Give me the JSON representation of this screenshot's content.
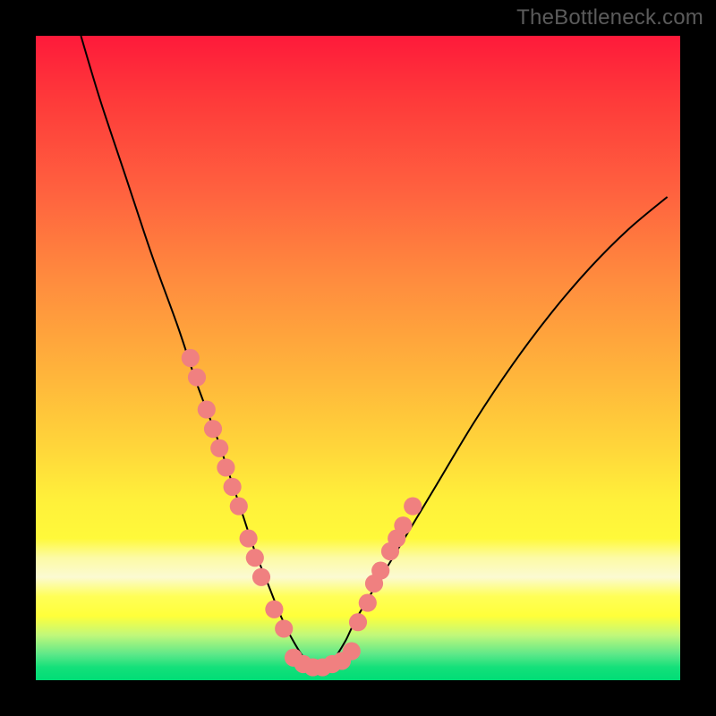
{
  "watermark": "TheBottleneck.com",
  "chart_data": {
    "type": "line",
    "title": "",
    "xlabel": "",
    "ylabel": "",
    "xlim": [
      0,
      100
    ],
    "ylim": [
      0,
      100
    ],
    "annotations": [],
    "series": [
      {
        "name": "curve",
        "type": "line",
        "color": "#000000",
        "x": [
          7,
          10,
          14,
          18,
          22,
          25,
          28,
          30,
          32,
          34,
          36,
          38,
          40,
          42,
          44,
          46,
          48,
          50,
          56,
          62,
          68,
          74,
          80,
          86,
          92,
          98
        ],
        "y": [
          100,
          90,
          78,
          66,
          55,
          46,
          38,
          32,
          26,
          20,
          15,
          10,
          6,
          3,
          2,
          3,
          6,
          10,
          20,
          30,
          40,
          49,
          57,
          64,
          70,
          75
        ],
        "comment": "V-shaped bottleneck curve; y=0 is optimal, higher = worse"
      },
      {
        "name": "dots-left",
        "type": "scatter",
        "color": "#f08080",
        "x": [
          24,
          25,
          26.5,
          27.5,
          28.5,
          29.5,
          30.5,
          31.5,
          33,
          34,
          35,
          37,
          38.5
        ],
        "y": [
          50,
          47,
          42,
          39,
          36,
          33,
          30,
          27,
          22,
          19,
          16,
          11,
          8
        ]
      },
      {
        "name": "dots-bottom",
        "type": "scatter",
        "color": "#f08080",
        "x": [
          40,
          41.5,
          43,
          44.5,
          46,
          47.5,
          49
        ],
        "y": [
          3.5,
          2.5,
          2,
          2,
          2.5,
          3,
          4.5
        ]
      },
      {
        "name": "dots-right",
        "type": "scatter",
        "color": "#f08080",
        "x": [
          50,
          51.5,
          52.5,
          53.5,
          55,
          56,
          57,
          58.5
        ],
        "y": [
          9,
          12,
          15,
          17,
          20,
          22,
          24,
          27
        ]
      }
    ],
    "background": {
      "type": "gradient",
      "description": "vertical gradient red (top) → orange → yellow → pale → green (bottom) indicating bottleneck severity"
    }
  },
  "colors": {
    "dot": "#f08080",
    "curve": "#000000",
    "frame": "#000000"
  }
}
